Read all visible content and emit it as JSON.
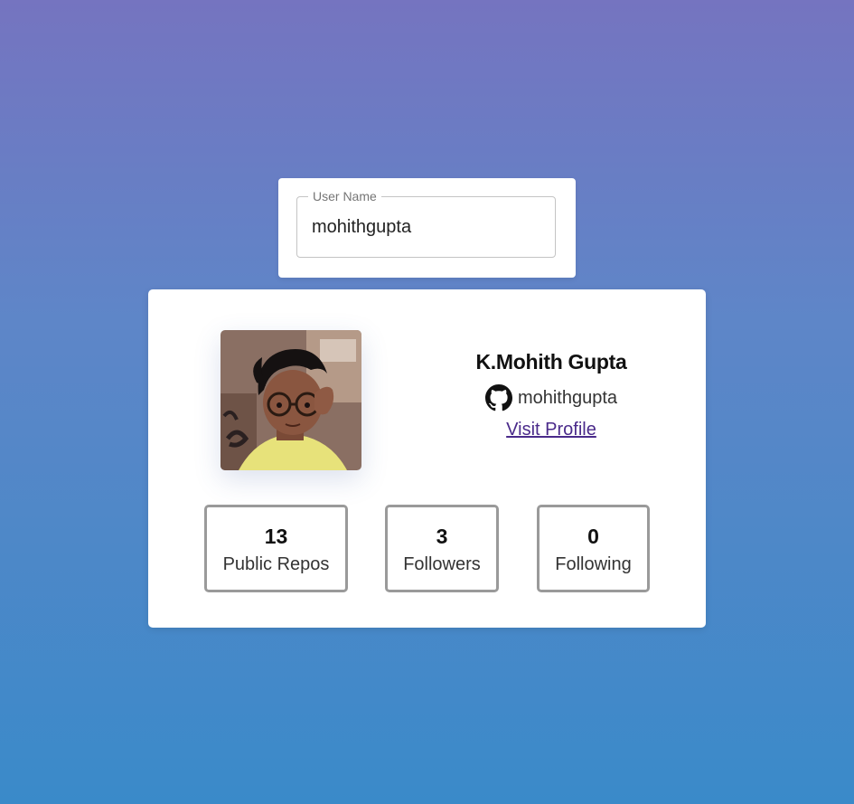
{
  "search": {
    "label": "User Name",
    "value": "mohithgupta"
  },
  "profile": {
    "full_name": "K.Mohith Gupta",
    "username": "mohithgupta",
    "visit_label": "Visit Profile",
    "avatar_icon": "user-avatar-photo",
    "github_icon": "github-icon"
  },
  "stats": {
    "repos": {
      "value": "13",
      "label": "Public Repos"
    },
    "followers": {
      "value": "3",
      "label": "Followers"
    },
    "following": {
      "value": "0",
      "label": "Following"
    }
  },
  "colors": {
    "bg_top": "#7574c0",
    "bg_bottom": "#3a8ac9",
    "link": "#4a2a8a",
    "stat_border": "#9a9a9a"
  }
}
